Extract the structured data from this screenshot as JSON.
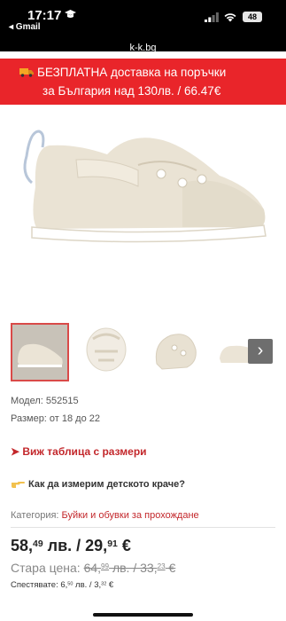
{
  "status_bar": {
    "time": "17:17",
    "back_app": "◂ Gmail",
    "battery": "48",
    "url": "k-k.bg"
  },
  "promo": {
    "line1": "БЕЗПЛАТНА доставка на поръчки",
    "line2": "за България над 130лв. / 66.47€",
    "background": "#e9252a"
  },
  "gallery": {
    "thumbnails": [
      "front-view",
      "sole-view",
      "toe-view",
      "side-view"
    ],
    "selected_index": 0,
    "next_icon": "chevron-right-icon"
  },
  "product": {
    "model": "Модел: 552515",
    "size": "Размер: от 18 до 22",
    "size_table_link": "➤ Виж таблица с размери",
    "measure_link": "Как да измерим детското краче?",
    "category_label": "Категория:",
    "category_value": "Буйки и обувки за прохождане"
  },
  "price": {
    "new_lev": "58,",
    "new_lev_cents": "49",
    "new_lev_unit": " лв. / 29,",
    "new_eur_cents": "91",
    "new_eur_unit": " €",
    "old_label": "Стара цена:",
    "old_lev": "64,",
    "old_lev_cents": "99",
    "old_lev_unit": " лв. / 33,",
    "old_eur_cents": "23",
    "old_eur_unit": " €",
    "save_label": "Спестявате:",
    "save_lev": "6,",
    "save_lev_cents": "50",
    "save_lev_unit": " лв. / 3,",
    "save_eur_cents": "32",
    "save_eur_unit": " €",
    "accent": "#c3272b"
  }
}
